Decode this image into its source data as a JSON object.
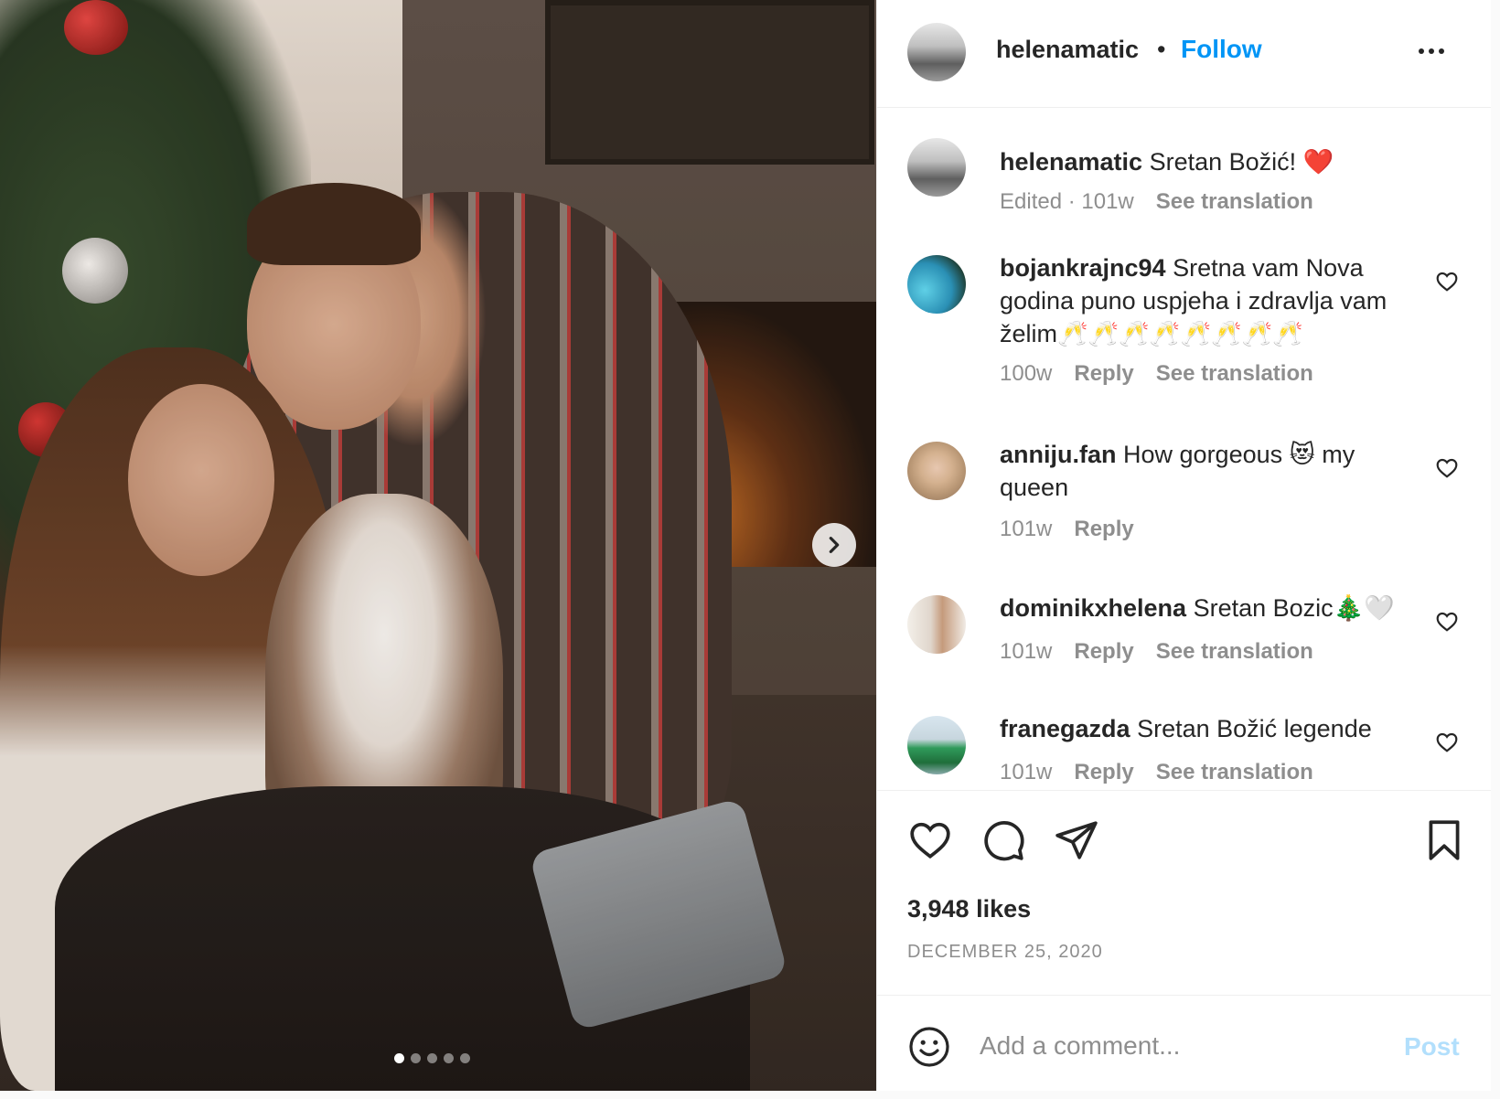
{
  "post": {
    "author": "helenamatic",
    "bullet": "•",
    "follow_label": "Follow",
    "likes": "3,948 likes",
    "date": "DECEMBER 25, 2020",
    "carousel": {
      "total": 5,
      "active_index": 0
    }
  },
  "caption": {
    "user": "helenamatic",
    "text": "Sretan Božić! ❤️",
    "edited": "Edited · 101w",
    "see_translation": "See translation"
  },
  "comments": [
    {
      "user": "bojankrajnc94",
      "text": "Sretna vam Nova godina puno uspjeha i zdravlja vam želim🥂🥂🥂🥂🥂🥂🥂🥂",
      "time": "100w",
      "reply": "Reply",
      "see_translation": "See translation"
    },
    {
      "user": "anniju.fan",
      "text": "How gorgeous 😻 my queen",
      "time": "101w",
      "reply": "Reply"
    },
    {
      "user": "dominikxhelena",
      "text": "Sretan Bozic🎄🤍",
      "time": "101w",
      "reply": "Reply",
      "see_translation": "See translation"
    },
    {
      "user": "franegazda",
      "text": "Sretan Božić legende",
      "time": "101w",
      "reply": "Reply",
      "see_translation": "See translation"
    }
  ],
  "add_comment": {
    "placeholder": "Add a comment...",
    "post_label": "Post"
  },
  "icons": {
    "like": "heart-icon",
    "comment": "comment-bubble-icon",
    "share": "paper-plane-icon",
    "save": "bookmark-icon",
    "emoji": "smiley-icon",
    "more": "ellipsis-icon",
    "next": "chevron-right-icon"
  },
  "colors": {
    "link_blue": "#0095f6",
    "post_disabled": "#b2dffc",
    "muted": "#8e8e8e",
    "text": "#262626"
  }
}
